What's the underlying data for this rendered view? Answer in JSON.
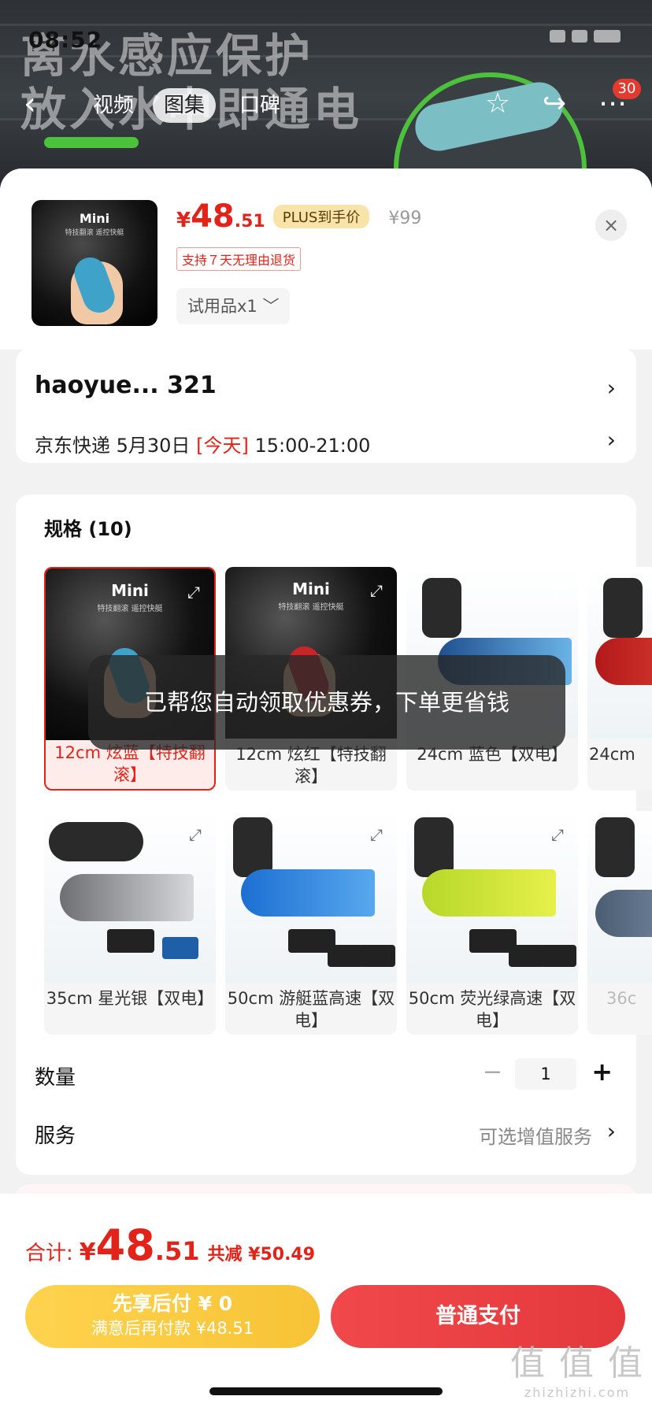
{
  "status": {
    "time": "08:52"
  },
  "background": {
    "line1": "离水感应保护",
    "line2": "放入水中即通电"
  },
  "nav": {
    "back": "‹",
    "tabs": [
      {
        "label": "视频"
      },
      {
        "label": "图集"
      },
      {
        "label": "口碑"
      }
    ],
    "cart_badge": "30"
  },
  "product": {
    "thumb_title": "Mini",
    "thumb_subtitle": "特技翻滚 遥控快艇",
    "price_symbol": "¥",
    "price_int": "48",
    "price_dec": ".51",
    "plus_tag": "PLUS到手价",
    "original_price": "¥99",
    "return_policy": "支持７天无理由退货",
    "trial_selector": "试用品x1 ﹀",
    "close": "×"
  },
  "address": {
    "name": "haoyue...  321",
    "ship_prefix": "京东快递 5月30日 ",
    "ship_today": "[今天]",
    "ship_window": " 15:00-21:00"
  },
  "spec": {
    "title": "规格 (10)",
    "options": [
      {
        "label": "12cm 炫蓝【特技翻滚】",
        "mini_title": "Mini",
        "mini_sub": "特技翻滚 遥控快艇",
        "selected": true
      },
      {
        "label": "12cm 炫红【特技翻滚】",
        "mini_title": "Mini",
        "mini_sub": "特技翻滚 遥控快艇",
        "selected": false
      },
      {
        "label": "24cm 蓝色【双电】",
        "selected": false
      },
      {
        "label": "24cm",
        "selected": false
      },
      {
        "label": "35cm 星光银【双电】",
        "selected": false
      },
      {
        "label": "50cm 游艇蓝高速【双电】",
        "selected": false
      },
      {
        "label": "50cm 荧光绿高速【双电】",
        "selected": false
      },
      {
        "label": "36c",
        "selected": false
      }
    ]
  },
  "toast": "已帮您自动领取优惠券，下单更省钱",
  "quantity": {
    "label": "数量",
    "minus": "−",
    "value": "1",
    "plus": "+"
  },
  "service": {
    "label": "服务",
    "hint": "可选增值服务"
  },
  "total": {
    "label": "合计:",
    "symbol": "¥",
    "int": "48",
    "dec": ".51",
    "saved": "共减 ¥50.49"
  },
  "buttons": {
    "later_line1": "先享后付 ¥ 0",
    "later_line2": "满意后再付款 ¥48.51",
    "pay": "普通支付"
  },
  "watermark": {
    "big": "值 值 值",
    "small": "zhizhizhi.com"
  },
  "colors": {
    "accent": "#e2231a",
    "plus_gold": "#f8e3a8",
    "pay_red": "#e4393c",
    "later_yellow": "#f7c336"
  }
}
